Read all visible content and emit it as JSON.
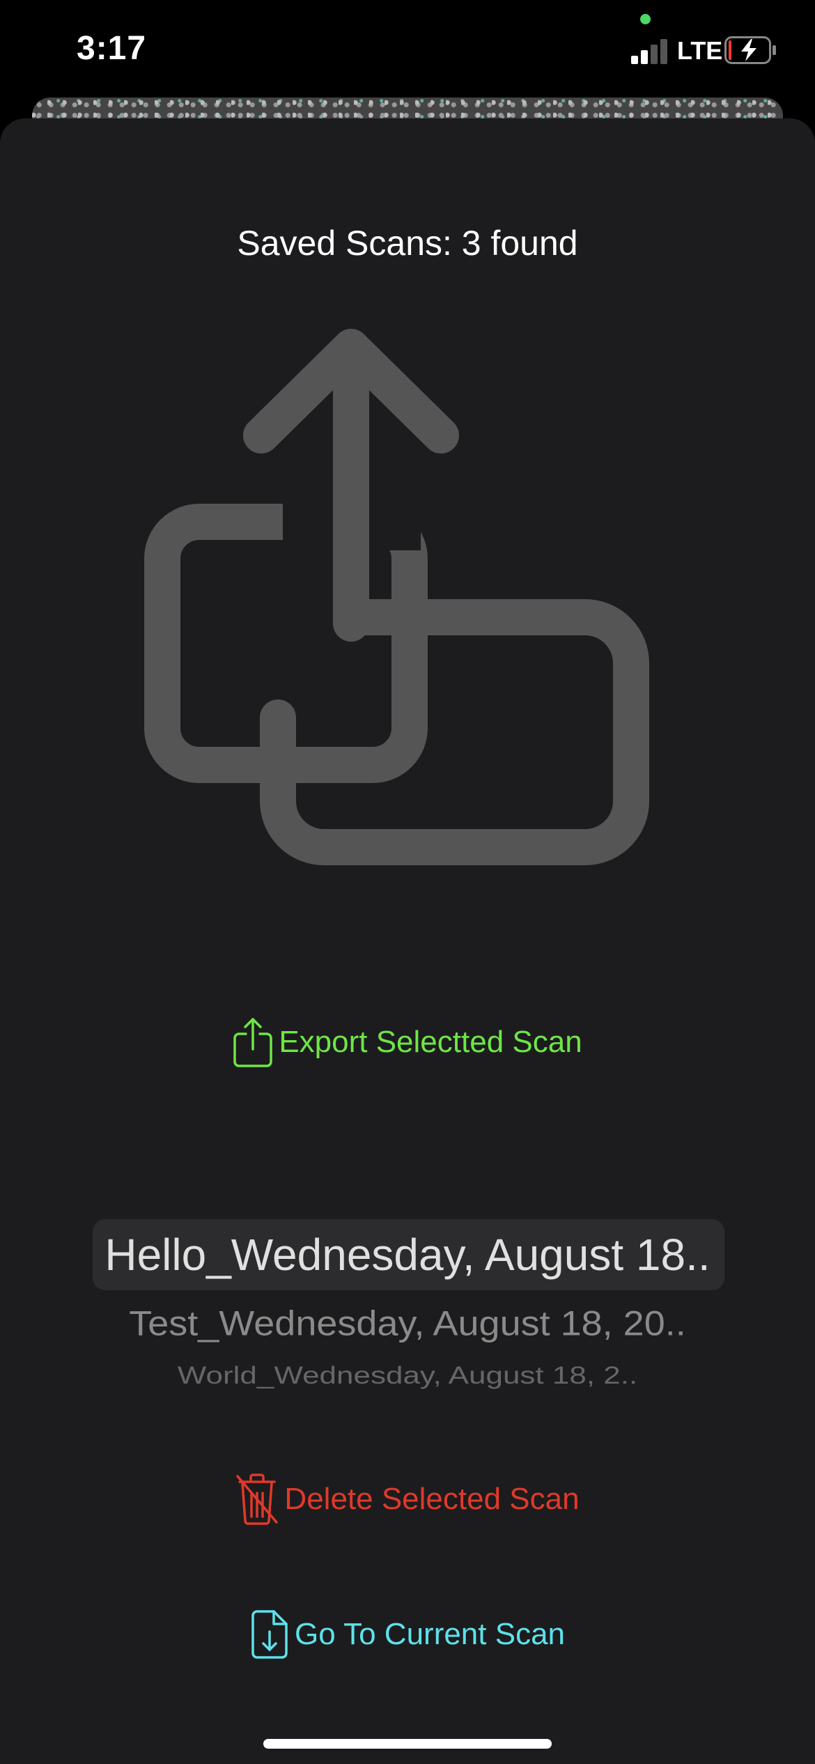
{
  "status_bar": {
    "time": "3:17",
    "network": "LTE"
  },
  "sheet": {
    "title": "Saved Scans: 3 found",
    "hero_icon": "share-documents-icon",
    "export": {
      "icon": "square-arrow-up-icon",
      "label": "Export Selectted Scan"
    },
    "picker": {
      "items": [
        "Hello_Wednesday, August 18..",
        "Test_Wednesday, August 18, 20..",
        "World_Wednesday, August 18, 2.."
      ]
    },
    "delete": {
      "icon": "trash-slash-icon",
      "label": "Delete Selected Scan"
    },
    "goto": {
      "icon": "document-arrow-down-icon",
      "label": "Go To Current Scan"
    }
  },
  "colors": {
    "sheet_background": "#1c1c1e",
    "export_accent": "#6ee646",
    "delete_accent": "#e0392a",
    "goto_accent": "#5de2ea",
    "hero_icon_gray": "#555555"
  }
}
